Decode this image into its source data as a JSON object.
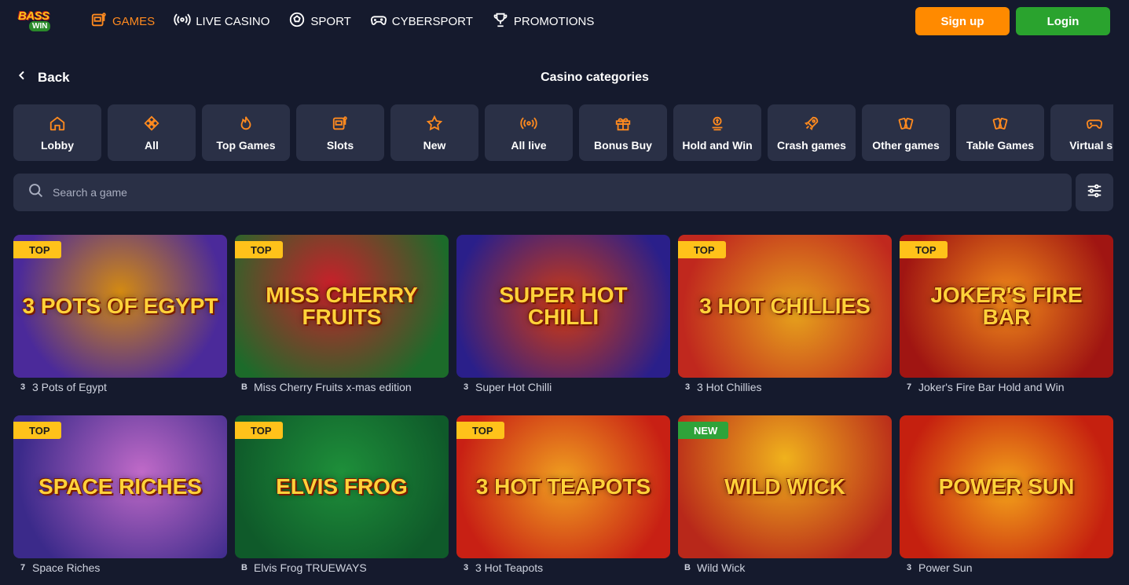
{
  "logo": {
    "text_top": "BASS",
    "text_bottom": "WIN"
  },
  "nav": [
    {
      "label": "GAMES",
      "icon": "slot-machine-icon",
      "active": true
    },
    {
      "label": "LIVE CASINO",
      "icon": "broadcast-icon",
      "active": false
    },
    {
      "label": "SPORT",
      "icon": "soccer-ball-icon",
      "active": false
    },
    {
      "label": "CYBERSPORT",
      "icon": "gamepad-icon",
      "active": false
    },
    {
      "label": "PROMOTIONS",
      "icon": "trophy-icon",
      "active": false
    }
  ],
  "auth": {
    "signup": "Sign up",
    "login": "Login"
  },
  "subheader": {
    "back": "Back",
    "title": "Casino categories"
  },
  "categories": [
    {
      "label": "Lobby",
      "icon": "home-icon"
    },
    {
      "label": "All",
      "icon": "diamond-icon"
    },
    {
      "label": "Top Games",
      "icon": "flame-icon"
    },
    {
      "label": "Slots",
      "icon": "slot-machine-icon"
    },
    {
      "label": "New",
      "icon": "star-icon"
    },
    {
      "label": "All live",
      "icon": "broadcast-icon"
    },
    {
      "label": "Bonus Buy",
      "icon": "gift-icon"
    },
    {
      "label": "Hold and Win",
      "icon": "coin-stack-icon"
    },
    {
      "label": "Crash games",
      "icon": "rocket-icon"
    },
    {
      "label": "Other games",
      "icon": "cards-icon"
    },
    {
      "label": "Table Games",
      "icon": "cards-icon"
    },
    {
      "label": "Virtual sp",
      "icon": "gamepad-icon"
    }
  ],
  "search": {
    "placeholder": "Search a game"
  },
  "games": [
    {
      "name": "3 Pots of Egypt",
      "thumb_title": "3 POTS OF EGYPT",
      "badge": "TOP",
      "provider_icon": "3",
      "bg": "#4b2a9a",
      "bg2": "#d38a12"
    },
    {
      "name": "Miss Cherry Fruits x-mas edition",
      "thumb_title": "MISS CHERRY FRUITS",
      "badge": "TOP",
      "provider_icon": "B",
      "bg": "#1c6b2a",
      "bg2": "#c8202a"
    },
    {
      "name": "Super Hot Chilli",
      "thumb_title": "SUPER HOT CHILLI",
      "badge": "",
      "provider_icon": "3",
      "bg": "#2a1f8a",
      "bg2": "#d23a10"
    },
    {
      "name": "3 Hot Chillies",
      "thumb_title": "3 HOT CHILLIES",
      "badge": "TOP",
      "provider_icon": "3",
      "bg": "#c0281e",
      "bg2": "#e6a11c"
    },
    {
      "name": "Joker's Fire Bar Hold and Win",
      "thumb_title": "JOKER'S FIRE BAR",
      "badge": "TOP",
      "provider_icon": "7",
      "bg": "#a01512",
      "bg2": "#f08a1a"
    },
    {
      "name": "Space Riches",
      "thumb_title": "SPACE RICHES",
      "badge": "TOP",
      "provider_icon": "7",
      "bg": "#3b2a8a",
      "bg2": "#c06ac8"
    },
    {
      "name": "Elvis Frog TRUEWAYS",
      "thumb_title": "ELVIS FROG",
      "badge": "TOP",
      "provider_icon": "B",
      "bg": "#0f5a2a",
      "bg2": "#1e8f3a"
    },
    {
      "name": "3 Hot Teapots",
      "thumb_title": "3 HOT TEAPOTS",
      "badge": "TOP",
      "provider_icon": "3",
      "bg": "#c82014",
      "bg2": "#f0a020"
    },
    {
      "name": "Wild Wick",
      "thumb_title": "WILD WICK",
      "badge": "NEW",
      "provider_icon": "B",
      "bg": "#b8281a",
      "bg2": "#f0b21c"
    },
    {
      "name": "Power Sun",
      "thumb_title": "POWER SUN",
      "badge": "",
      "provider_icon": "3",
      "bg": "#c5200f",
      "bg2": "#f3a21a"
    }
  ],
  "colors": {
    "bg": "#151a2d",
    "card": "#2a3046",
    "accent": "#ff8a1f",
    "signup": "#ff8a00",
    "login": "#2aa32e",
    "badge_top": "#ffc21a",
    "badge_new": "#2fa33a"
  }
}
